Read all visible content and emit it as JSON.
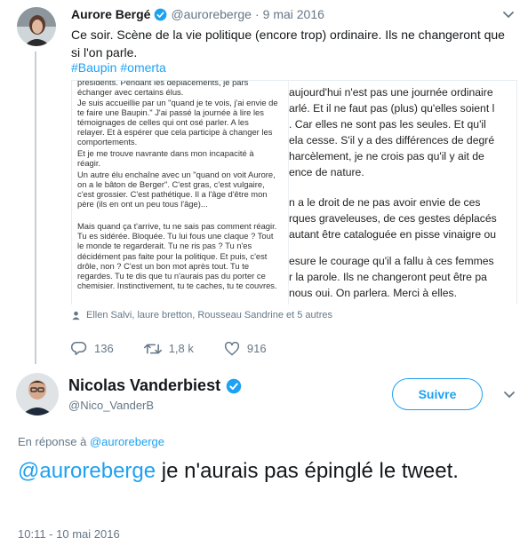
{
  "tweet1": {
    "author_name": "Aurore Bergé",
    "handle": "@auroreberge",
    "separator": "·",
    "date": "9 mai 2016",
    "text": "Ce soir. Scène de la vie politique (encore trop) ordinaire. Ils ne changeront que si l'on parle.",
    "hashtags": [
      "#Baupin",
      "#omerta"
    ],
    "media_left_lines": [
      "présidents. Pendant les déplacements, je pars",
      "échanger avec certains élus.",
      "Je suis accueillie par un \"quand je te vois, j'ai envie de",
      "te faire une Baupin.\" J'ai passé la journée à lire les",
      "témoignages de celles qui ont osé parler. A les",
      "relayer. Et à espérer que cela participe à changer les",
      "comportements.",
      "Et je me trouve navrante dans mon incapacité à",
      "réagir.",
      "Un autre élu enchaîne avec un \"quand on voit Aurore,",
      "on a le bâton de Berger\". C'est gras, c'est vulgaire,",
      "c'est grossier. C'est pathétique. Il a l'âge d'être mon",
      "père  (ils en ont un peu tous l'âge)...",
      "Mais quand ça t'arrive, tu ne sais pas comment réagir.",
      "Tu es sidérée. Bloquée. Tu lui fous une claque ? Tout",
      "le monde te regarderait. Tu ne ris pas ? Tu n'es",
      "décidément pas faite pour la politique. Et puis, c'est",
      "drôle, non ? C'est un bon mot après tout. Tu te",
      "regardes. Tu te dis que tu n'aurais pas du porter ce",
      "chemisier. Instinctivement, tu te caches, tu te couvres."
    ],
    "media_right_lines": [
      "aujourd'hui n'est pas une journée ordinaire",
      "arlé. Et il ne faut pas (plus) qu'elles soient l",
      ". Car elles ne sont pas les seules. Et qu'il",
      "ela cesse. S'il y a des différences de degré",
      "harcèlement, je ne crois pas qu'il y ait de",
      "ence de nature.",
      "n a le droit de ne pas avoir envie de ces",
      "rques graveleuses, de ces gestes déplacés",
      "autant être cataloguée en pisse vinaigre ou",
      "esure le courage qu'il a fallu à ces femmes",
      "r la parole. Ils ne changeront peut être pa",
      "nous oui. On parlera. Merci à elles."
    ],
    "tagged_people": "Ellen Salvi, laure bretton, Rousseau Sandrine et 5 autres",
    "replies": "136",
    "retweets": "1,8 k",
    "likes": "916"
  },
  "tweet2": {
    "author_name": "Nicolas Vanderbiest",
    "handle": "@Nico_VanderB",
    "follow_label": "Suivre",
    "reply_prefix": "En réponse à",
    "reply_handle": "@auroreberge",
    "mention": "@auroreberge",
    "text": " je n'aurais pas épinglé le tweet.",
    "timestamp": "10:11 - 10 mai 2016"
  },
  "colors": {
    "accent": "#1da1f2",
    "muted": "#657786",
    "text": "#14171a"
  }
}
